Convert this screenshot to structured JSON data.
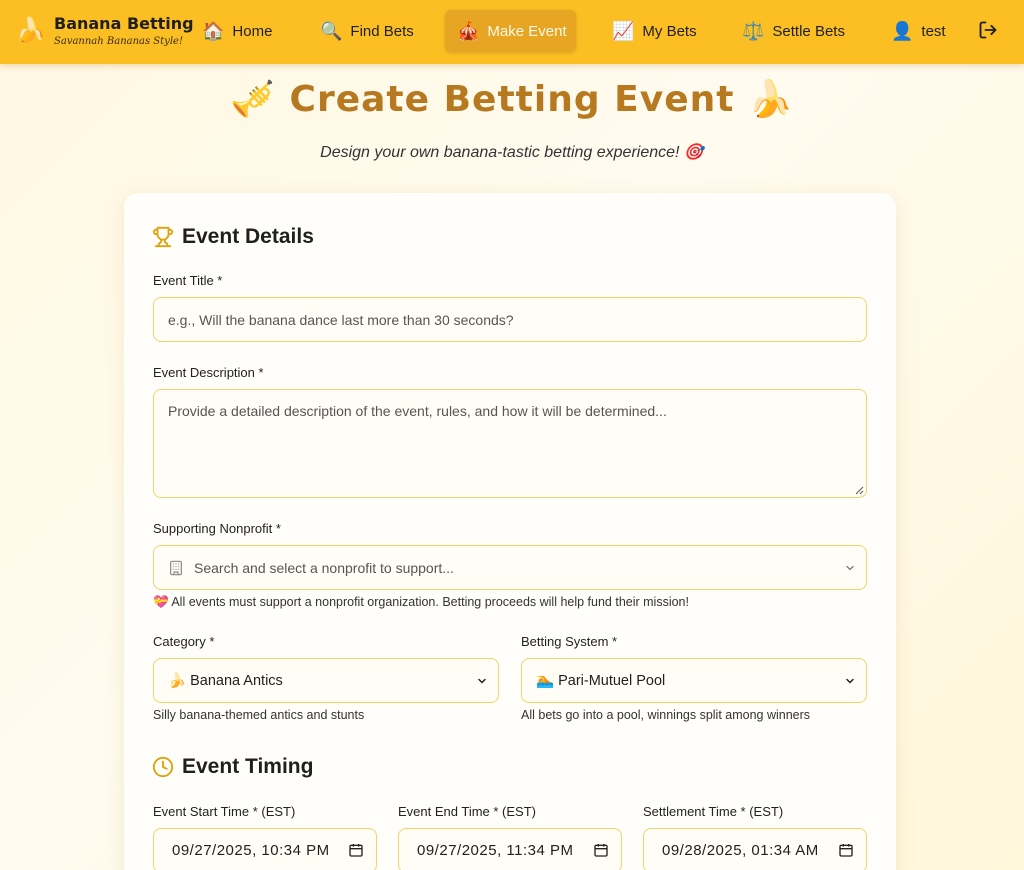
{
  "brand": {
    "logo_emoji": "🍌",
    "title": "Banana Betting",
    "subtitle": "Savannah Bananas Style!"
  },
  "nav": {
    "items": [
      {
        "icon": "🏠",
        "label": "Home"
      },
      {
        "icon": "🔍",
        "label": "Find Bets"
      },
      {
        "icon": "🎪",
        "label": "Make Event",
        "active": true
      },
      {
        "icon": "📈",
        "label": "My Bets"
      },
      {
        "icon": "⚖️",
        "label": "Settle Bets"
      }
    ],
    "user": {
      "icon": "👤",
      "label": "test"
    }
  },
  "page": {
    "title_left_emoji": "🎺",
    "title": "Create Betting Event",
    "title_right_emoji": "🍌",
    "subtitle": "Design your own banana-tastic betting experience! 🎯"
  },
  "details": {
    "heading": "Event Details",
    "title_label": "Event Title *",
    "title_placeholder": "e.g., Will the banana dance last more than 30 seconds?",
    "desc_label": "Event Description *",
    "desc_placeholder": "Provide a detailed description of the event, rules, and how it will be determined...",
    "nonprofit_label": "Supporting Nonprofit *",
    "nonprofit_placeholder": "Search and select a nonprofit to support...",
    "nonprofit_help": "💝 All events must support a nonprofit organization. Betting proceeds will help fund their mission!",
    "category_label": "Category *",
    "category_value": "🍌 Banana Antics",
    "category_help": "Silly banana-themed antics and stunts",
    "system_label": "Betting System *",
    "system_value": "🏊 Pari-Mutuel Pool",
    "system_help": "All bets go into a pool, winnings split among winners"
  },
  "timing": {
    "heading": "Event Timing",
    "start_label": "Event Start Time * (EST)",
    "start_value": "09/27/2025, 10:34 PM",
    "end_label": "Event End Time * (EST)",
    "end_value": "09/27/2025, 11:34 PM",
    "settle_label": "Settlement Time * (EST)",
    "settle_value": "09/28/2025, 01:34 AM"
  },
  "colors": {
    "header": "#fbbf24",
    "accent": "#b7791f",
    "active_nav": "#e6a623",
    "input_border": "#f1d36b"
  }
}
